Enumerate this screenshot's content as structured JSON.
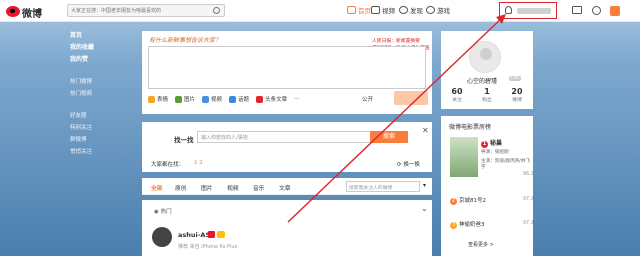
{
  "topbar": {
    "logo_text": "微博",
    "search_placeholder": "大家正在搜：中国老年朋友为啥最喜欢的",
    "nav": [
      {
        "label": "首页",
        "icon": "home-icon",
        "active": true
      },
      {
        "label": "视频",
        "icon": "video-icon"
      },
      {
        "label": "发现",
        "icon": "compass-icon"
      },
      {
        "label": "游戏",
        "icon": "game-icon"
      }
    ],
    "username_hidden": true
  },
  "left_nav": {
    "items": [
      "首页",
      "我的收藏",
      "我的赞",
      "热门微博",
      "热门视频",
      "好友圈",
      "特别关注",
      "群微博",
      "悄悄关注"
    ]
  },
  "composer": {
    "hint": "有什么新鲜事想告诉大家？",
    "hot_text": "人民日报：新闻置换要求“请家”，微信也成为莫医的优者",
    "hot_label": "热门微博",
    "tools": [
      "表情",
      "图片",
      "视频",
      "话题",
      "头条文章"
    ],
    "tool_colors": [
      "#f6a623",
      "#5a9e2f",
      "#4a90e2",
      "#3b8ad9",
      "#e0242c"
    ],
    "more": "···",
    "visibility": "公开",
    "send_label": ""
  },
  "find_people": {
    "label": "找一找",
    "placeholder": "输入你想找的人/事物",
    "button": "搜索",
    "all_label": "大家都在找：",
    "pages": "1 2",
    "change": "换一换"
  },
  "feed_tabs": {
    "tabs": [
      "全部",
      "原创",
      "图片",
      "视频",
      "音乐",
      "文章"
    ],
    "search_placeholder": "搜索我关注人的微博"
  },
  "feed": {
    "hot_label": "热门",
    "user": "ashui-AS",
    "source": "推荐 来自 iPhone 6s Plus"
  },
  "profile": {
    "nickname": "心空的碧瑾",
    "level": "Lv6",
    "stats": [
      {
        "value": "60",
        "label": "关注"
      },
      {
        "value": "1",
        "label": "粉丝"
      },
      {
        "value": "20",
        "label": "微博"
      }
    ]
  },
  "movie": {
    "title": "微博电影票房榜",
    "first": {
      "rank": "1",
      "name": "秘巢",
      "director": "导演：张绍刚",
      "cast": "主演：凯丽/颜丙燕/林飞宇",
      "score": "96.1"
    },
    "rows": [
      {
        "rank": "2",
        "name": "京城81号2",
        "score": "97.1"
      },
      {
        "rank": "3",
        "name": "神偷奶爸3",
        "score": "97.1"
      }
    ],
    "more": "查看更多 >",
    "rank_colors": [
      "#e0242c",
      "#fa7d3c",
      "#f6a623"
    ]
  },
  "annotation": {
    "color": "#e0242c"
  }
}
